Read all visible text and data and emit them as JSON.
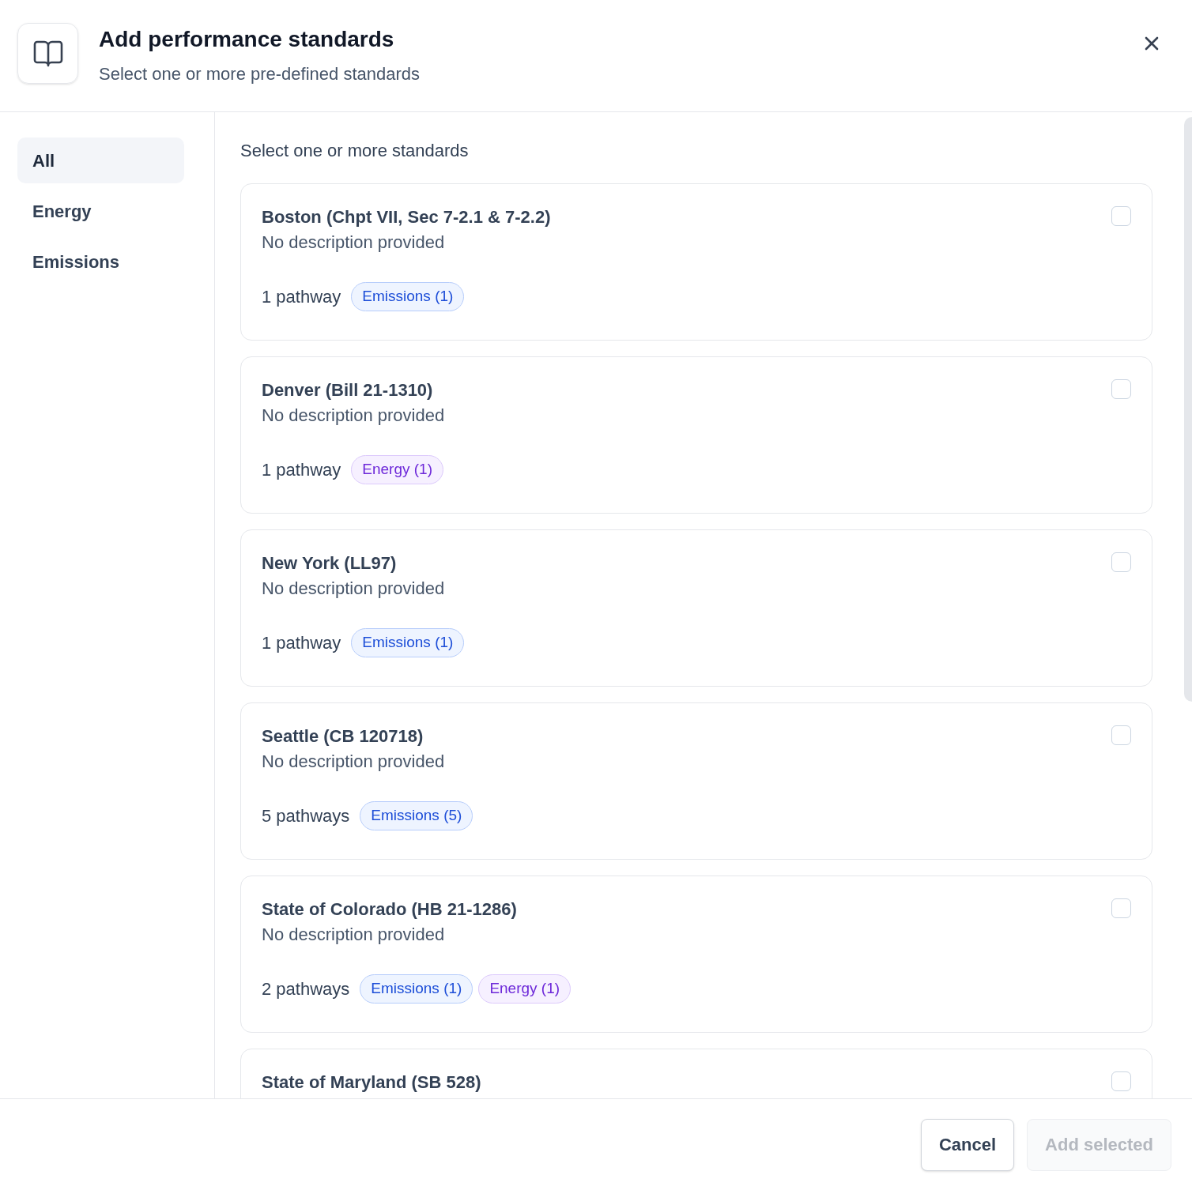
{
  "dialog": {
    "title": "Add performance standards",
    "subtitle": "Select one or more pre-defined standards"
  },
  "sidebar": {
    "items": [
      {
        "label": "All",
        "selected": true
      },
      {
        "label": "Energy",
        "selected": false
      },
      {
        "label": "Emissions",
        "selected": false
      }
    ]
  },
  "content": {
    "heading": "Select one or more standards",
    "standards": [
      {
        "title": "Boston (Chpt VII, Sec 7-2.1 & 7-2.2)",
        "description": "No description provided",
        "pathways": "1 pathway",
        "checked": false,
        "tags": [
          {
            "kind": "emissions",
            "label": "Emissions (1)"
          }
        ]
      },
      {
        "title": "Denver (Bill 21-1310)",
        "description": "No description provided",
        "pathways": "1 pathway",
        "checked": false,
        "tags": [
          {
            "kind": "energy",
            "label": "Energy (1)"
          }
        ]
      },
      {
        "title": "New York (LL97)",
        "description": "No description provided",
        "pathways": "1 pathway",
        "checked": false,
        "tags": [
          {
            "kind": "emissions",
            "label": "Emissions (1)"
          }
        ]
      },
      {
        "title": "Seattle (CB 120718)",
        "description": "No description provided",
        "pathways": "5 pathways",
        "checked": false,
        "tags": [
          {
            "kind": "emissions",
            "label": "Emissions (5)"
          }
        ]
      },
      {
        "title": "State of Colorado (HB 21-1286)",
        "description": "No description provided",
        "pathways": "2 pathways",
        "checked": false,
        "tags": [
          {
            "kind": "emissions",
            "label": "Emissions (1)"
          },
          {
            "kind": "energy",
            "label": "Energy (1)"
          }
        ]
      },
      {
        "title": "State of Maryland (SB 528)",
        "checked": false
      }
    ]
  },
  "footer": {
    "buttons": [
      {
        "label": "Cancel",
        "disabled": false
      },
      {
        "label": "Add selected",
        "disabled": true
      }
    ]
  }
}
